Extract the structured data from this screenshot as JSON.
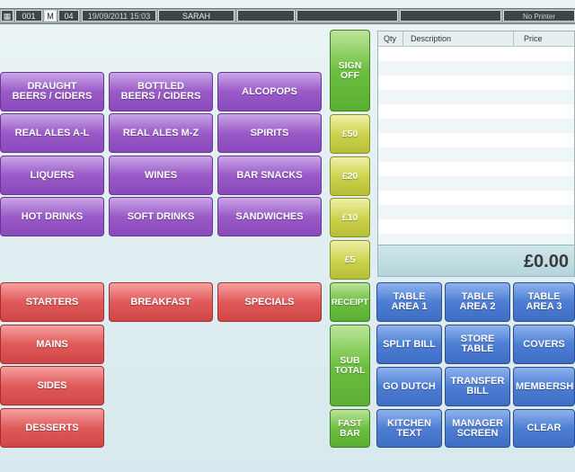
{
  "topbar": {
    "terminal": "001",
    "mode": "M",
    "screen": "04",
    "datetime": "19/09/2011 15:03",
    "user": "SARAH",
    "printer": "No Printer"
  },
  "categories_top": [
    [
      "DRAUGHT\nBEERS / CIDERS",
      "BOTTLED\nBEERS / CIDERS",
      "ALCOPOPS"
    ],
    [
      "REAL ALES A-L",
      "REAL ALES M-Z",
      "SPIRITS"
    ],
    [
      "LIQUERS",
      "WINES",
      "BAR SNACKS"
    ],
    [
      "HOT DRINKS",
      "SOFT DRINKS",
      "SANDWICHES"
    ]
  ],
  "categories_food": [
    "STARTERS",
    "BREAKFAST",
    "SPECIALS",
    "MAINS",
    "SIDES",
    "DESSERTS"
  ],
  "middle": {
    "sign_off": "SIGN\nOFF",
    "cash50": "£50",
    "cash20": "£20",
    "cash10": "£10",
    "cash5": "£5",
    "receipt": "RECEIPT",
    "sub_total": "SUB\nTOTAL",
    "fast_bar": "FAST\nBAR"
  },
  "order": {
    "col_qty": "Qty",
    "col_desc": "Description",
    "col_price": "Price",
    "total": "£0.00"
  },
  "functions": [
    [
      "TABLE\nAREA 1",
      "TABLE\nAREA 2",
      "TABLE\nAREA 3"
    ],
    [
      "SPLIT BILL",
      "STORE\nTABLE",
      "COVERS"
    ],
    [
      "GO DUTCH",
      "TRANSFER\nBILL",
      "MEMBERSHIP"
    ],
    [
      "KITCHEN\nTEXT",
      "MANAGER\nSCREEN",
      "CLEAR"
    ]
  ],
  "colors": {
    "category_purple": "#9a5ac8",
    "food_red": "#e05a5a",
    "function_blue": "#4d7ed4",
    "action_green": "#6cc040",
    "cash_yellow": "#c9d24a"
  }
}
